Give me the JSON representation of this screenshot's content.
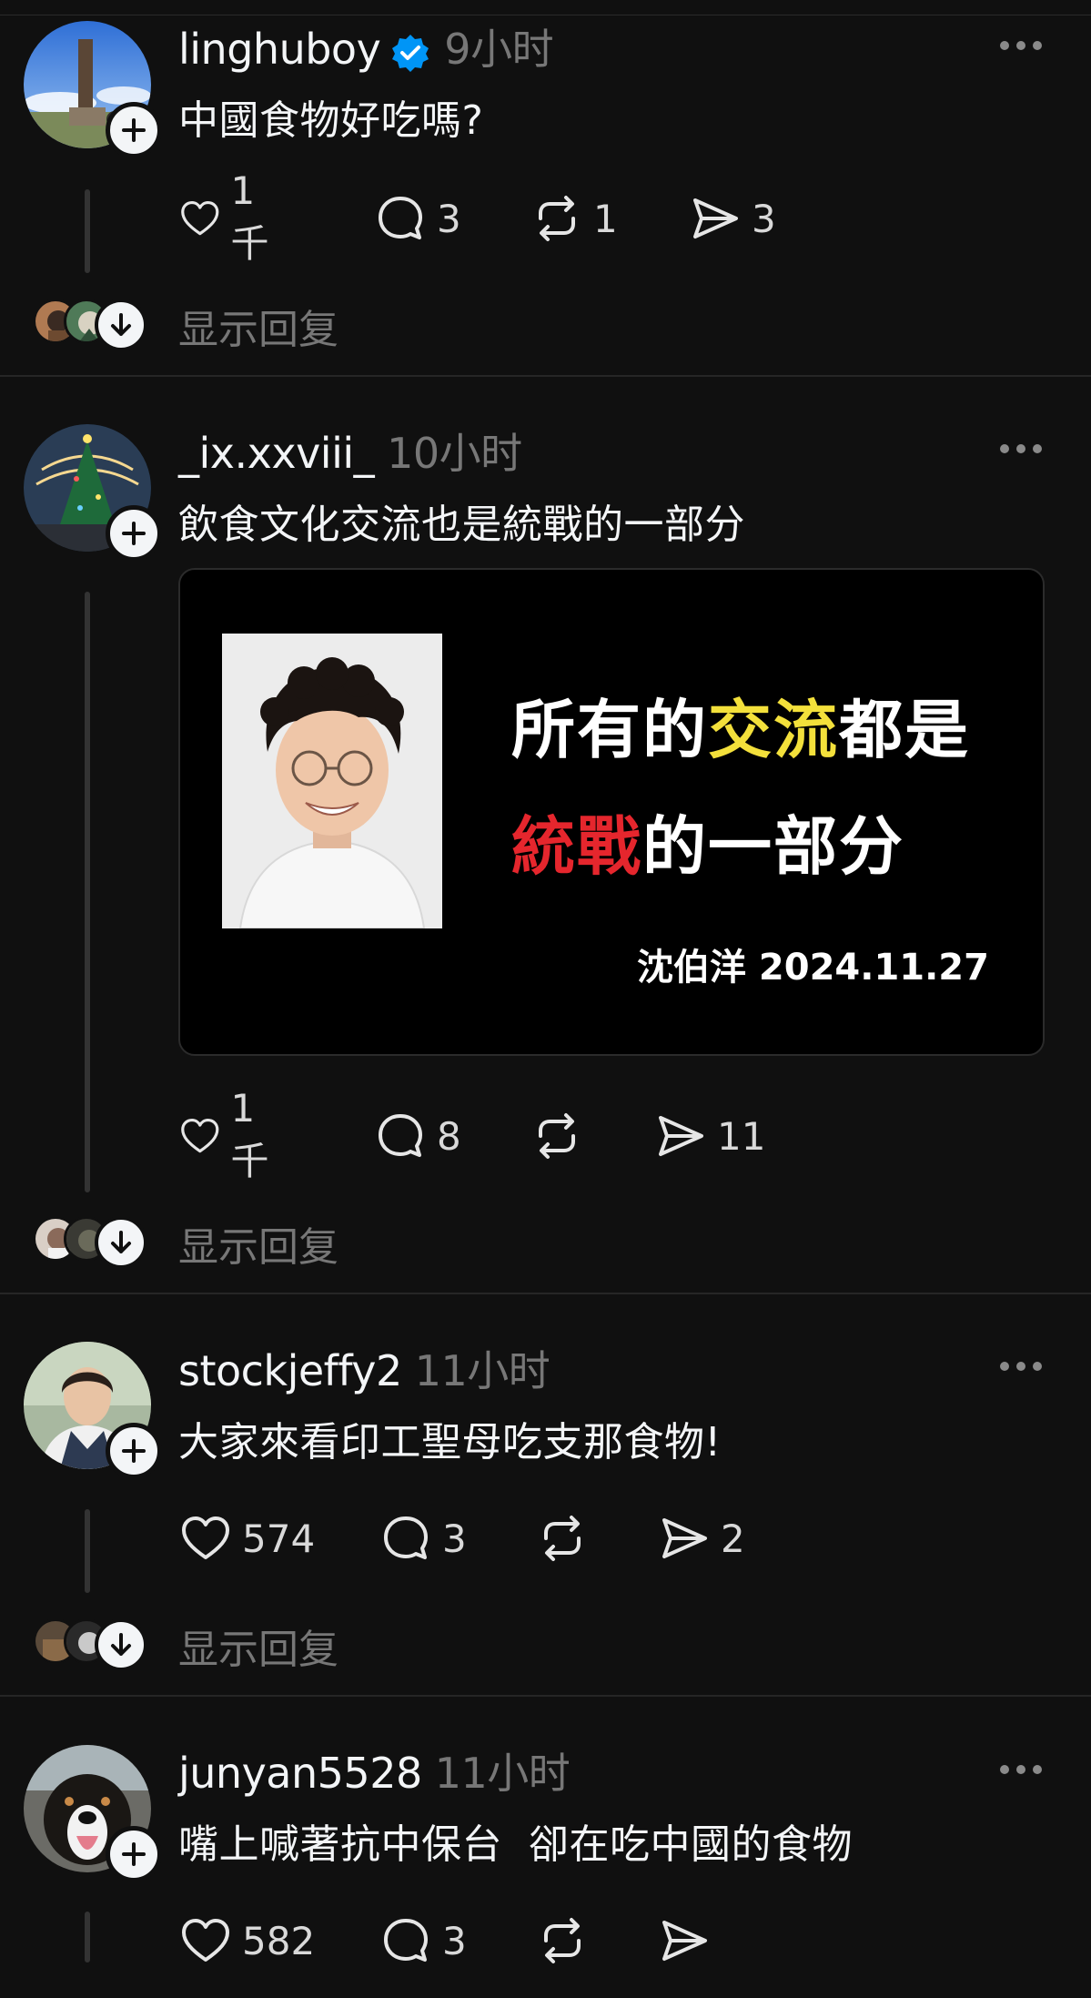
{
  "posts": [
    {
      "username": "linghuboy",
      "time": "9小时",
      "verified": true,
      "text": "中國食物好吃嗎?",
      "likes": "1千",
      "comments": "3",
      "reposts": "1",
      "shares": "3"
    },
    {
      "username": "_ix.xxviii_",
      "time": "10小时",
      "verified": false,
      "text": "飲食文化交流也是統戰的一部分",
      "likes": "1千",
      "comments": "8",
      "reposts": "",
      "shares": "11",
      "image": {
        "line1_a": "所有的",
        "line1_b": "交流",
        "line1_c": "都是",
        "line2_a": "統戰",
        "line2_b": "的一部分",
        "signature": "沈伯洋 2024.11.27",
        "highlight_yellow": "#f3e03b",
        "highlight_red": "#e5262d"
      }
    },
    {
      "username": "stockjeffy2",
      "time": "11小时",
      "verified": false,
      "text": "大家來看印工聖母吃支那食物!",
      "likes": "574",
      "comments": "3",
      "reposts": "",
      "shares": "2"
    },
    {
      "username": "junyan5528",
      "time": "11小时",
      "verified": false,
      "text": "嘴上喊著抗中保台  卻在吃中國的食物",
      "likes": "582",
      "comments": "3",
      "reposts": "",
      "shares": ""
    }
  ],
  "show_replies_label": "显示回复",
  "icons": {
    "like": "heart-icon",
    "comment": "speech-bubble-icon",
    "repost": "repost-icon",
    "share": "send-icon",
    "more": "ellipsis-icon",
    "follow": "plus-icon",
    "verified": "verified-badge-icon"
  },
  "colors": {
    "background": "#101010",
    "text": "#f3f5f7",
    "muted": "#777777",
    "verified": "#0095f6"
  }
}
